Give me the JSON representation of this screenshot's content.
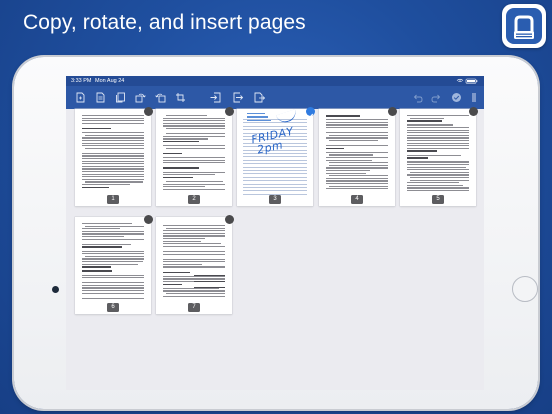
{
  "headline": "Copy, rotate, and insert pages",
  "status_bar": {
    "time": "3:33 PM",
    "date": "Mon Aug 24",
    "battery": "100%"
  },
  "toolbar": {
    "icons": [
      "new-page-icon",
      "document-icon",
      "copy-pages-icon",
      "rotate-left-icon",
      "rotate-right-icon",
      "crop-page-icon",
      "insert-before-icon",
      "insert-after-icon",
      "export-pages-icon",
      "undo-icon",
      "redo-icon",
      "select-all-icon",
      "more-icon"
    ]
  },
  "pages": [
    {
      "number": "1",
      "kind": "text"
    },
    {
      "number": "2",
      "kind": "text"
    },
    {
      "number": "3",
      "kind": "handwriting",
      "selected": true,
      "handwriting": [
        "FRIDAY",
        "2pm"
      ]
    },
    {
      "number": "4",
      "kind": "text"
    },
    {
      "number": "5",
      "kind": "text"
    },
    {
      "number": "6",
      "kind": "text"
    },
    {
      "number": "7",
      "kind": "form"
    }
  ],
  "colors": {
    "background": "#1f4f9f",
    "toolbar": "#2d58a6",
    "accent": "#2f7be0"
  }
}
